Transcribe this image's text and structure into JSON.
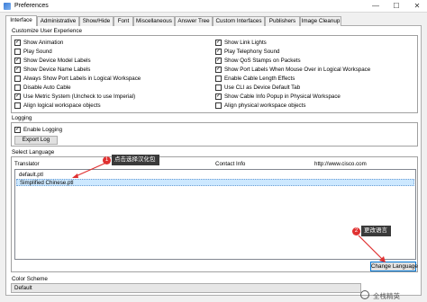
{
  "window": {
    "title": "Preferences",
    "buttons": {
      "minimize": "—",
      "maximize": "☐",
      "close": "✕"
    }
  },
  "tabs": [
    "Interface",
    "Administrative",
    "Show/Hide",
    "Font",
    "Miscellaneous",
    "Answer Tree",
    "Custom Interfaces",
    "Publishers",
    "Image Cleanup"
  ],
  "customize": {
    "title": "Customize User Experience",
    "left": [
      {
        "label": "Show Animation",
        "checked": true
      },
      {
        "label": "Play Sound",
        "checked": false
      },
      {
        "label": "Show Device Model Labels",
        "checked": true
      },
      {
        "label": "Show Device Name Labels",
        "checked": true
      },
      {
        "label": "Always Show Port Labels in Logical Workspace",
        "checked": false
      },
      {
        "label": "Disable Auto Cable",
        "checked": false
      },
      {
        "label": "Use Metric System (Uncheck to use Imperial)",
        "checked": true
      },
      {
        "label": "Align logical workspace objects",
        "checked": false
      }
    ],
    "right": [
      {
        "label": "Show Link Lights",
        "checked": true
      },
      {
        "label": "Play Telephony Sound",
        "checked": true
      },
      {
        "label": "Show QoS Stamps on Packets",
        "checked": true
      },
      {
        "label": "Show Port Labels When Mouse Over in Logical Workspace",
        "checked": true
      },
      {
        "label": "Enable Cable Length Effects",
        "checked": false
      },
      {
        "label": "Use CLI as Device Default Tab",
        "checked": false
      },
      {
        "label": "Show Cable Info Popup in Physical Workspace",
        "checked": true
      },
      {
        "label": "Align physical workspace objects",
        "checked": false
      }
    ]
  },
  "logging": {
    "title": "Logging",
    "enable_label": "Enable Logging",
    "enable_checked": true,
    "export_button": "Export Log"
  },
  "language": {
    "title": "Select Language",
    "columns": {
      "translator": "Translator",
      "contact": "Contact Info",
      "website": "http://www.cisco.com"
    },
    "rows": [
      {
        "name": "default.ptl",
        "selected": false
      },
      {
        "name": "Simplified Chinese.ptl",
        "selected": true
      }
    ],
    "change_button": "Change Language"
  },
  "annotations": {
    "callout1": {
      "num": "1",
      "text": "点击选择汉化包"
    },
    "callout2": {
      "num": "2",
      "text": "更改语言"
    },
    "arrow_color": "#e03131"
  },
  "color_scheme": {
    "title": "Color Scheme",
    "value": "Default"
  },
  "watermark": "全栈精英"
}
